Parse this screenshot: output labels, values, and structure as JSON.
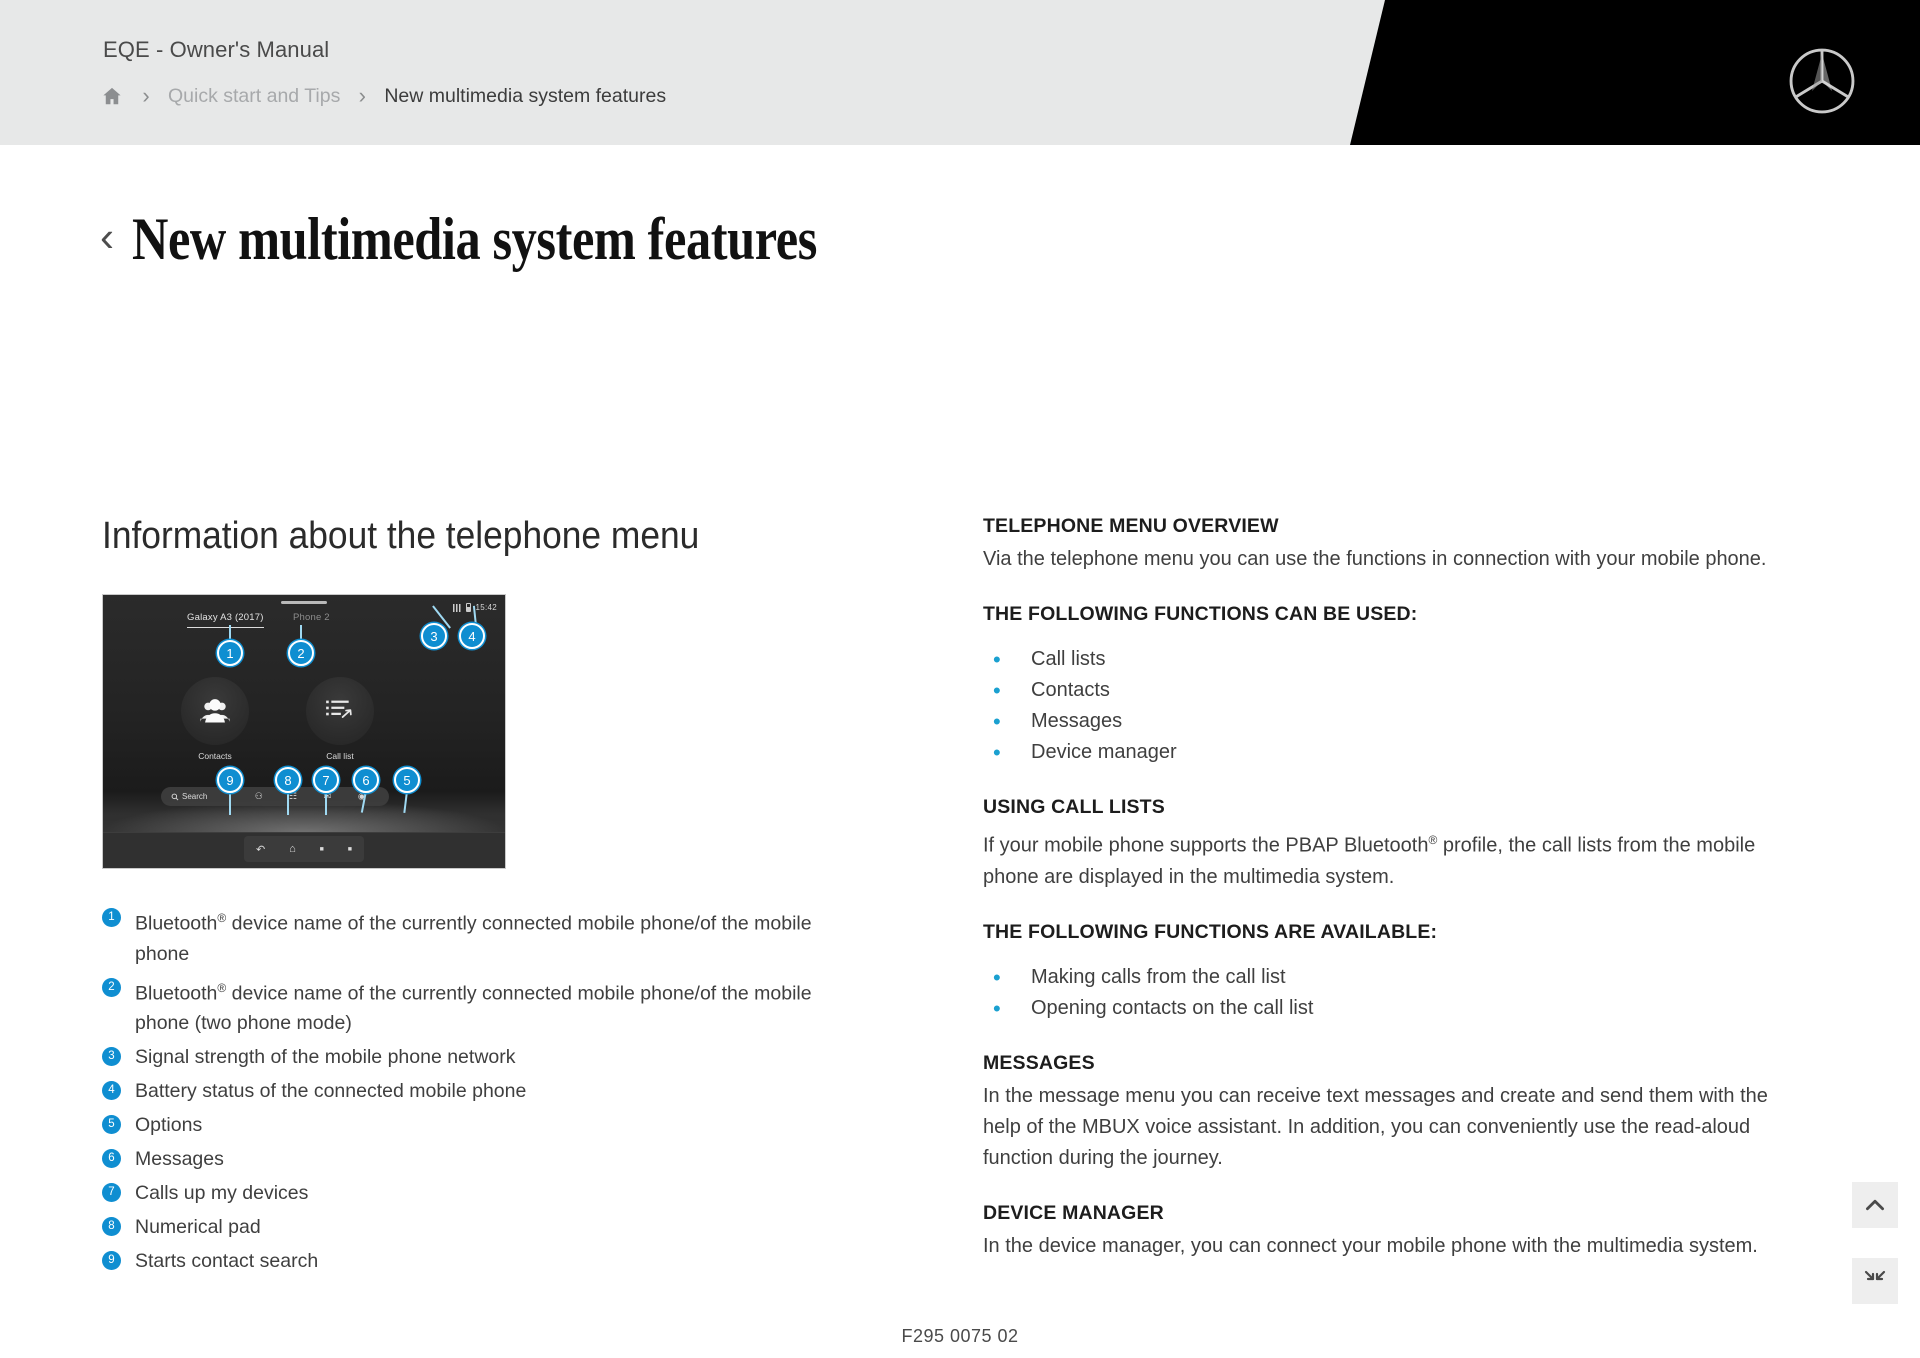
{
  "header": {
    "brand_title": "EQE - Owner's Manual",
    "breadcrumb": {
      "home_icon": "home-icon",
      "separator": "›",
      "parent": "Quick start and Tips",
      "current": "New multimedia system features"
    },
    "logo": "mercedes-benz-star-logo"
  },
  "page": {
    "back_chevron": "‹",
    "title": "New multimedia system features",
    "footer_code": "F295 0075 02"
  },
  "left": {
    "section_heading": "Information about the telephone menu",
    "illustration": {
      "tab_primary": "Galaxy A3 (2017)",
      "tab_secondary": "Phone 2",
      "status_time": "15:42",
      "signal_icon": "signal-bars-icon",
      "battery_icon": "battery-icon",
      "tile_contacts_label": "Contacts",
      "tile_contacts_icon": "contacts-people-icon",
      "tile_calllist_label": "Call list",
      "tile_calllist_icon": "call-list-icon",
      "search_label": "Search",
      "search_icon": "search-icon",
      "dock_icons": [
        "numpad-icon",
        "devices-icon",
        "messages-icon",
        "options-icon"
      ],
      "bottom_bar_icons": [
        "back-arrow-icon",
        "home-icon",
        "page-dot-icon",
        "page-dot-icon"
      ],
      "callouts": [
        "1",
        "2",
        "3",
        "4",
        "5",
        "6",
        "7",
        "8",
        "9"
      ]
    },
    "legend": [
      {
        "num": "1",
        "text_a": "Bluetooth",
        "sup": "®",
        "text_b": " device name of the currently connected mobile phone/of the mobile phone"
      },
      {
        "num": "2",
        "text_a": "Bluetooth",
        "sup": "®",
        "text_b": " device name of the currently connected mobile phone/of the mobile phone (two phone mode)"
      },
      {
        "num": "3",
        "text_a": "Signal strength of the mobile phone network",
        "sup": "",
        "text_b": ""
      },
      {
        "num": "4",
        "text_a": "Battery status of the connected mobile phone",
        "sup": "",
        "text_b": ""
      },
      {
        "num": "5",
        "text_a": "Options",
        "sup": "",
        "text_b": ""
      },
      {
        "num": "6",
        "text_a": "Messages",
        "sup": "",
        "text_b": ""
      },
      {
        "num": "7",
        "text_a": "Calls up my devices",
        "sup": "",
        "text_b": ""
      },
      {
        "num": "8",
        "text_a": "Numerical pad",
        "sup": "",
        "text_b": ""
      },
      {
        "num": "9",
        "text_a": "Starts contact search",
        "sup": "",
        "text_b": ""
      }
    ]
  },
  "right": {
    "b1_heading": "TELEPHONE MENU OVERVIEW",
    "b1_body": "Via the telephone menu you can use the functions in connection with your mobile phone.",
    "b2_heading": "THE FOLLOWING FUNCTIONS CAN BE USED:",
    "b2_items": [
      "Call lists",
      "Contacts",
      "Messages",
      "Device manager"
    ],
    "b3_heading": "USING CALL LISTS",
    "b3_body_a": "If your mobile phone supports the PBAP Bluetooth",
    "b3_sup": "®",
    "b3_body_b": " profile, the call lists from the mobile phone are displayed in the multimedia system.",
    "b4_heading": "THE FOLLOWING FUNCTIONS ARE AVAILABLE:",
    "b4_items": [
      "Making calls from the call list",
      "Opening contacts on the call list"
    ],
    "b5_heading": "MESSAGES",
    "b5_body": "In the message menu you can receive text messages and create and send them with the help of the MBUX voice assistant. In addition, you can conveniently use the read-aloud function during the journey.",
    "b6_heading": "DEVICE MANAGER",
    "b6_body": "In the device manager, you can connect your mobile phone with the multimedia system.",
    "bullet_glyph": "•"
  },
  "side_buttons": {
    "scroll_top_icon": "chevron-up-icon",
    "collapse_icon": "collapse-arrows-icon"
  },
  "colors": {
    "accent_blue": "#0f8ed1",
    "bullet_blue": "#1aa0d0",
    "header_bg": "#e7e8e8",
    "header_black": "#000000",
    "body_text": "#3f3f3f"
  }
}
